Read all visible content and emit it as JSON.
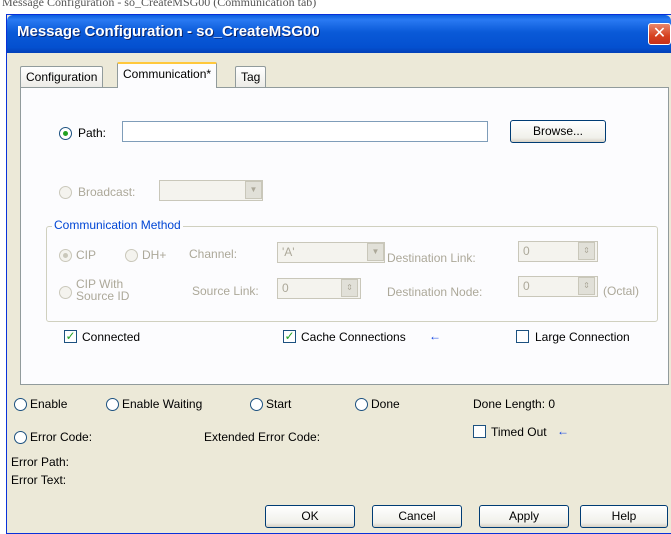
{
  "window": {
    "title": "Message Configuration - so_CreateMSG00",
    "close_glyph": "✕"
  },
  "top_caption": "Message Configuration - so_CreateMSG00 (Communication tab)",
  "tabs": [
    {
      "label": "Configuration"
    },
    {
      "label": "Communication*"
    },
    {
      "label": "Tag"
    }
  ],
  "path": {
    "label": "Path:",
    "value": "",
    "browse_label": "Browse..."
  },
  "broadcast": {
    "label": "Broadcast:"
  },
  "comm_method": {
    "title": "Communication Method",
    "cip_label": "CIP",
    "dhplus_label": "DH+",
    "cip_with_source_label_line1": "CIP With",
    "cip_with_source_label_line2": "Source ID",
    "channel_label": "Channel:",
    "channel_value": "'A'",
    "source_link_label": "Source Link:",
    "source_link_value": "0",
    "dest_link_label": "Destination Link:",
    "dest_link_value": "0",
    "dest_node_label": "Destination Node:",
    "dest_node_value": "0",
    "octal_label": "(Octal)"
  },
  "options": {
    "connected_label": "Connected",
    "cache_label": "Cache Connections",
    "large_label": "Large Connection",
    "arrow_glyph": "←"
  },
  "status": {
    "enable_label": "Enable",
    "enable_waiting_label": "Enable Waiting",
    "start_label": "Start",
    "done_label": "Done",
    "done_length_label": "Done Length: 0",
    "error_code_label": "Error Code:",
    "extended_error_label": "Extended Error Code:",
    "timed_out_label": "Timed Out",
    "error_path_label": "Error Path:",
    "error_text_label": "Error Text:"
  },
  "buttons": {
    "ok": "OK",
    "cancel": "Cancel",
    "apply": "Apply",
    "help": "Help"
  },
  "colors": {
    "title_bar": "#0a5ad8",
    "dialog_bg": "#ece9d8",
    "group_title": "#0046d5",
    "check_green": "#21a121"
  }
}
